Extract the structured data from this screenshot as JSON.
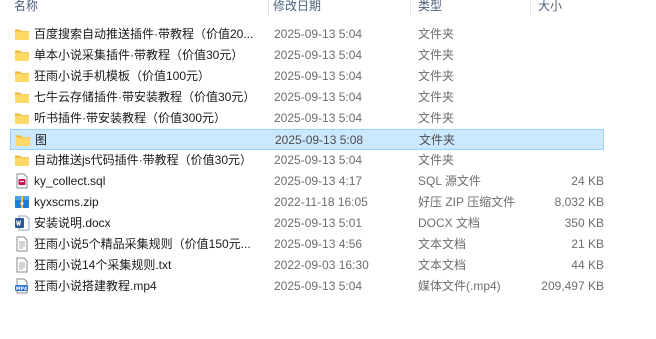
{
  "columns": {
    "name": "名称",
    "date": "修改日期",
    "type": "类型",
    "size": "大小"
  },
  "files": [
    {
      "icon": "folder-icon",
      "name": "百度搜索自动推送插件·带教程（价值20...",
      "date": "2025-09-13 5:04",
      "type": "文件夹",
      "size": ""
    },
    {
      "icon": "folder-icon",
      "name": "单本小说采集插件·带教程（价值30元）",
      "date": "2025-09-13 5:04",
      "type": "文件夹",
      "size": ""
    },
    {
      "icon": "folder-icon",
      "name": "狂雨小说手机模板（价值100元）",
      "date": "2025-09-13 5:04",
      "type": "文件夹",
      "size": ""
    },
    {
      "icon": "folder-icon",
      "name": "七牛云存储插件·带安装教程（价值30元）",
      "date": "2025-09-13 5:04",
      "type": "文件夹",
      "size": ""
    },
    {
      "icon": "folder-icon",
      "name": "听书插件·带安装教程（价值300元）",
      "date": "2025-09-13 5:04",
      "type": "文件夹",
      "size": ""
    },
    {
      "icon": "folder-icon",
      "name": "图",
      "date": "2025-09-13 5:08",
      "type": "文件夹",
      "size": "",
      "selected": true
    },
    {
      "icon": "folder-icon",
      "name": "自动推送js代码插件·带教程（价值30元）",
      "date": "2025-09-13 5:04",
      "type": "文件夹",
      "size": ""
    },
    {
      "icon": "sql-file-icon",
      "name": "ky_collect.sql",
      "date": "2025-09-13 4:17",
      "type": "SQL 源文件",
      "size": "24 KB"
    },
    {
      "icon": "zip-archive-icon",
      "name": "kyxscms.zip",
      "date": "2022-11-18 16:05",
      "type": "好压 ZIP 压缩文件",
      "size": "8,032 KB"
    },
    {
      "icon": "word-document-icon",
      "name": "安装说明.docx",
      "date": "2025-09-13 5:01",
      "type": "DOCX 文档",
      "size": "350 KB"
    },
    {
      "icon": "text-file-icon",
      "name": "狂雨小说5个精品采集规则（价值150元...",
      "date": "2025-09-13 4:56",
      "type": "文本文档",
      "size": "21 KB"
    },
    {
      "icon": "text-file-icon",
      "name": "狂雨小说14个采集规则.txt",
      "date": "2022-09-03 16:30",
      "type": "文本文档",
      "size": "44 KB"
    },
    {
      "icon": "mp4-video-icon",
      "name": "狂雨小说搭建教程.mp4",
      "date": "2025-09-13 5:04",
      "type": "媒体文件(.mp4)",
      "size": "209,497 KB"
    }
  ]
}
